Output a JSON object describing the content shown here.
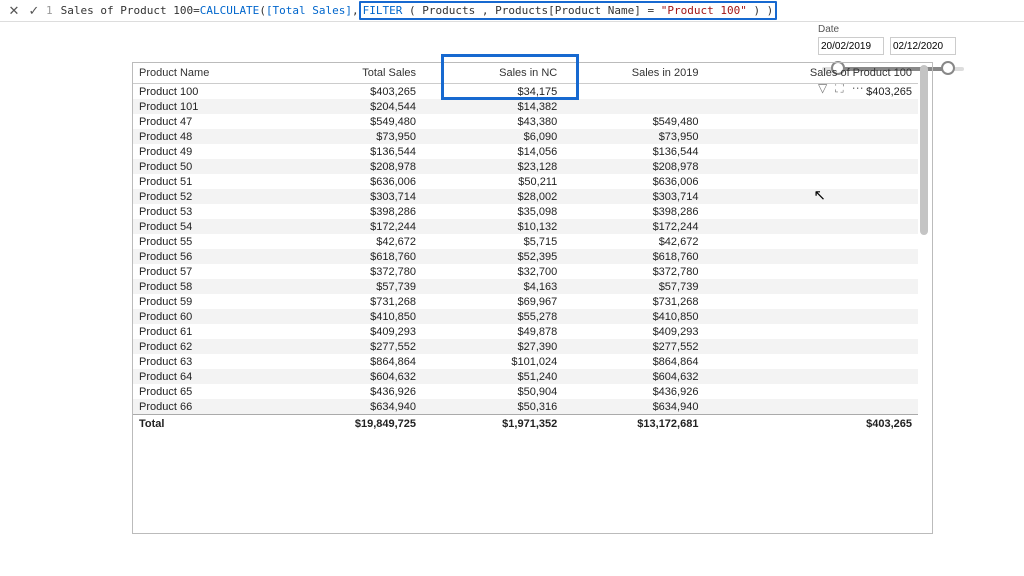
{
  "formula": {
    "line_no": "1",
    "measure_name": "Sales of Product 100",
    "equals": " = ",
    "fn_calculate": "CALCULATE",
    "p1_open": "( ",
    "col_total_sales": "[Total Sales]",
    "sep": ", ",
    "fn_filter": "FILTER",
    "p2_open": "( ",
    "tbl": "Products",
    "sep2": ", ",
    "col_prodname": "Products[Product Name]",
    "eq": " = ",
    "str_val": "\"Product 100\"",
    "close": " ) )"
  },
  "date_slicer": {
    "label": "Date",
    "from": "20/02/2019",
    "to": "02/12/2020"
  },
  "table": {
    "headers": [
      "Product Name",
      "Total Sales",
      "Sales in NC",
      "Sales in 2019",
      "Sales of Product 100"
    ],
    "rows": [
      {
        "name": "Product 100",
        "total": "$403,265",
        "nc": "$34,175",
        "y": "",
        "p100": "$403,265"
      },
      {
        "name": "Product 101",
        "total": "$204,544",
        "nc": "$14,382",
        "y": "",
        "p100": ""
      },
      {
        "name": "Product 47",
        "total": "$549,480",
        "nc": "$43,380",
        "y": "$549,480",
        "p100": ""
      },
      {
        "name": "Product 48",
        "total": "$73,950",
        "nc": "$6,090",
        "y": "$73,950",
        "p100": ""
      },
      {
        "name": "Product 49",
        "total": "$136,544",
        "nc": "$14,056",
        "y": "$136,544",
        "p100": ""
      },
      {
        "name": "Product 50",
        "total": "$208,978",
        "nc": "$23,128",
        "y": "$208,978",
        "p100": ""
      },
      {
        "name": "Product 51",
        "total": "$636,006",
        "nc": "$50,211",
        "y": "$636,006",
        "p100": ""
      },
      {
        "name": "Product 52",
        "total": "$303,714",
        "nc": "$28,002",
        "y": "$303,714",
        "p100": ""
      },
      {
        "name": "Product 53",
        "total": "$398,286",
        "nc": "$35,098",
        "y": "$398,286",
        "p100": ""
      },
      {
        "name": "Product 54",
        "total": "$172,244",
        "nc": "$10,132",
        "y": "$172,244",
        "p100": ""
      },
      {
        "name": "Product 55",
        "total": "$42,672",
        "nc": "$5,715",
        "y": "$42,672",
        "p100": ""
      },
      {
        "name": "Product 56",
        "total": "$618,760",
        "nc": "$52,395",
        "y": "$618,760",
        "p100": ""
      },
      {
        "name": "Product 57",
        "total": "$372,780",
        "nc": "$32,700",
        "y": "$372,780",
        "p100": ""
      },
      {
        "name": "Product 58",
        "total": "$57,739",
        "nc": "$4,163",
        "y": "$57,739",
        "p100": ""
      },
      {
        "name": "Product 59",
        "total": "$731,268",
        "nc": "$69,967",
        "y": "$731,268",
        "p100": ""
      },
      {
        "name": "Product 60",
        "total": "$410,850",
        "nc": "$55,278",
        "y": "$410,850",
        "p100": ""
      },
      {
        "name": "Product 61",
        "total": "$409,293",
        "nc": "$49,878",
        "y": "$409,293",
        "p100": ""
      },
      {
        "name": "Product 62",
        "total": "$277,552",
        "nc": "$27,390",
        "y": "$277,552",
        "p100": ""
      },
      {
        "name": "Product 63",
        "total": "$864,864",
        "nc": "$101,024",
        "y": "$864,864",
        "p100": ""
      },
      {
        "name": "Product 64",
        "total": "$604,632",
        "nc": "$51,240",
        "y": "$604,632",
        "p100": ""
      },
      {
        "name": "Product 65",
        "total": "$436,926",
        "nc": "$50,904",
        "y": "$436,926",
        "p100": ""
      },
      {
        "name": "Product 66",
        "total": "$634,940",
        "nc": "$50,316",
        "y": "$634,940",
        "p100": ""
      }
    ],
    "totals": {
      "label": "Total",
      "total": "$19,849,725",
      "nc": "$1,971,352",
      "y": "$13,172,681",
      "p100": "$403,265"
    }
  }
}
